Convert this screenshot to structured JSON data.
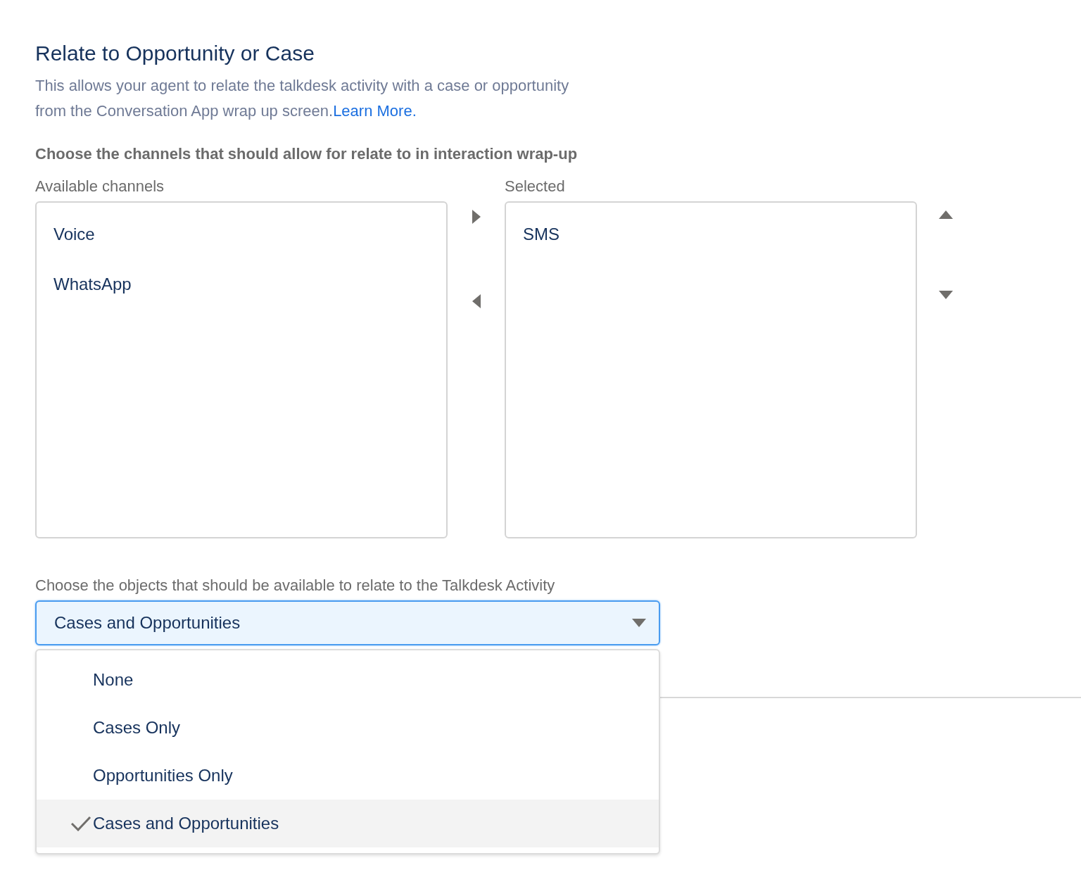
{
  "section": {
    "title": "Relate to Opportunity or Case",
    "description": "This allows your agent to relate the talkdesk activity with a case or opportunity from the Conversation App wrap up screen.",
    "link": "Learn More."
  },
  "channels": {
    "heading": "Choose the channels that should allow for relate to in interaction wrap-up",
    "available_label": "Available channels",
    "available": [
      "Voice",
      "WhatsApp"
    ],
    "selected_label": "Selected",
    "selected": [
      "SMS"
    ]
  },
  "objects": {
    "label": "Choose the objects that should be available to relate to the Talkdesk Activity",
    "value": "Cases and Opportunities",
    "expanded": true,
    "options": [
      {
        "label": "None",
        "selected": false
      },
      {
        "label": "Cases Only",
        "selected": false
      },
      {
        "label": "Opportunities Only",
        "selected": false
      },
      {
        "label": "Cases and Opportunities",
        "selected": true
      }
    ]
  }
}
